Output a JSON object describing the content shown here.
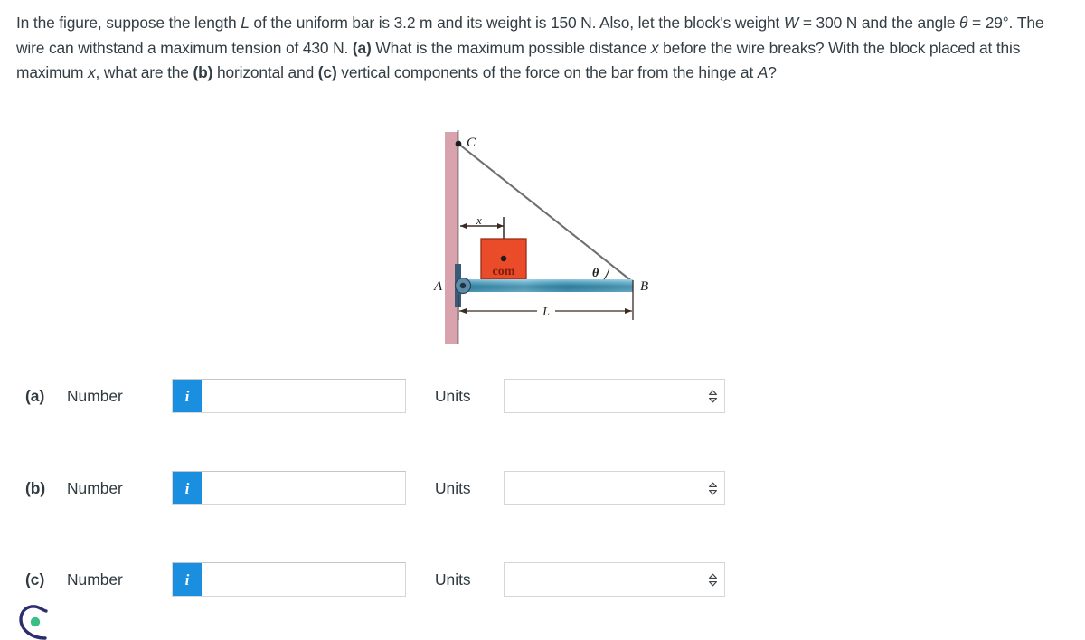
{
  "problem": {
    "line1_a": "In the figure, suppose the length ",
    "var_L": "L",
    "line1_b": " of the uniform bar is 3.2 m and its weight is 150 N. Also, let the block's weight ",
    "var_W": "W",
    "line1_c": " = 300 N",
    "line2_a": "and the angle ",
    "var_theta": "θ",
    "line2_b": " = 29°. The wire can withstand a maximum tension of 430 N. ",
    "label_a": "(a)",
    "line2_c": " What is the maximum possible distance ",
    "var_x1": "x",
    "line3_a": "before the wire breaks? With the block placed at this maximum ",
    "var_x2": "x",
    "line3_b": ", what are the ",
    "label_b": "(b)",
    "line3_c": " horizontal and ",
    "label_c": "(c)",
    "line3_d": " vertical",
    "line4_a": "components of the force on the bar from the hinge at ",
    "var_A": "A",
    "line4_b": "?",
    "values": {
      "bar_length_L": "3.2 m",
      "bar_weight": "150 N",
      "block_weight_W": "300 N",
      "angle_theta": "29°",
      "max_tension": "430 N"
    }
  },
  "figure": {
    "labels": {
      "point_c": "C",
      "point_a": "A",
      "point_b": "B",
      "dim_x": "x",
      "dim_L": "L",
      "angle": "θ",
      "block": "com"
    },
    "colors": {
      "wall": "#d9a3ad",
      "wall_edge": "#3c3c3c",
      "bar_top": "#9fd3e6",
      "bar_mid": "#2e7e9e",
      "bar_bottom": "#4f97b5",
      "block": "#ea4b28",
      "block_border": "#9c2d18",
      "wire": "#6f6f6f",
      "hinge": "#3b5a78",
      "dimension": "#3a2a22"
    }
  },
  "answers": {
    "units_selected": "",
    "rows": [
      {
        "id": "a",
        "label": "(a)",
        "number_label": "Number",
        "info_glyph": "i",
        "value": "",
        "placeholder": "",
        "units_label": "Units",
        "units_value": "",
        "units_arrow": "⇅"
      },
      {
        "id": "b",
        "label": "(b)",
        "number_label": "Number",
        "info_glyph": "i",
        "value": "",
        "placeholder": "",
        "units_label": "Units",
        "units_value": "",
        "units_arrow": "⇅"
      },
      {
        "id": "c",
        "label": "(c)",
        "number_label": "Number",
        "info_glyph": "i",
        "value": "",
        "placeholder": "",
        "units_label": "Units",
        "units_value": "",
        "units_arrow": "⇅"
      }
    ]
  },
  "corner_logo": {
    "name": "partial-brand-logo",
    "outline_color": "#2b2d6e",
    "dot_color": "#3bbd8a"
  }
}
